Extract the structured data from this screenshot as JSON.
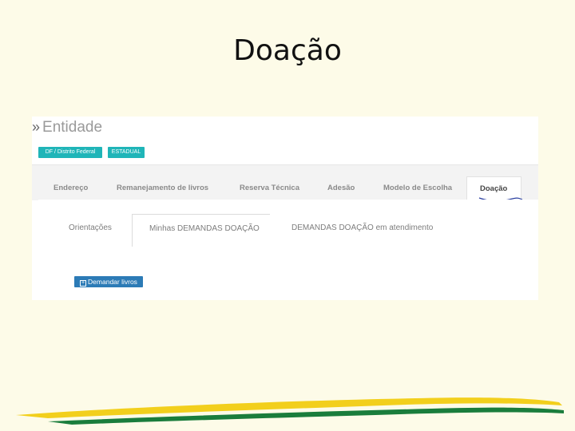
{
  "slide": {
    "title": "Doação"
  },
  "entity": {
    "chevron": "»",
    "title": "Entidade"
  },
  "badges": {
    "location": "DF / Distrito Federal",
    "level": "ESTADUAL"
  },
  "tabs": [
    {
      "label": "Endereço"
    },
    {
      "label": "Remanejamento de livros"
    },
    {
      "label": "Reserva Técnica"
    },
    {
      "label": "Adesão"
    },
    {
      "label": "Modelo de Escolha"
    },
    {
      "label": "Doação"
    }
  ],
  "subtabs": [
    {
      "label": "Orientações"
    },
    {
      "label": "Minhas DEMANDAS DOAÇÃO"
    },
    {
      "label": "DEMANDAS DOAÇÃO em atendimento"
    }
  ],
  "actions": {
    "demand_label": "Demandar livros",
    "demand_icon": "plus-square-icon"
  },
  "colors": {
    "background": "#fdfbe8",
    "badge": "#1fb5b8",
    "button": "#2c7bb6",
    "stripe_yellow": "#f2cf1c",
    "stripe_green": "#1a7d3c"
  }
}
